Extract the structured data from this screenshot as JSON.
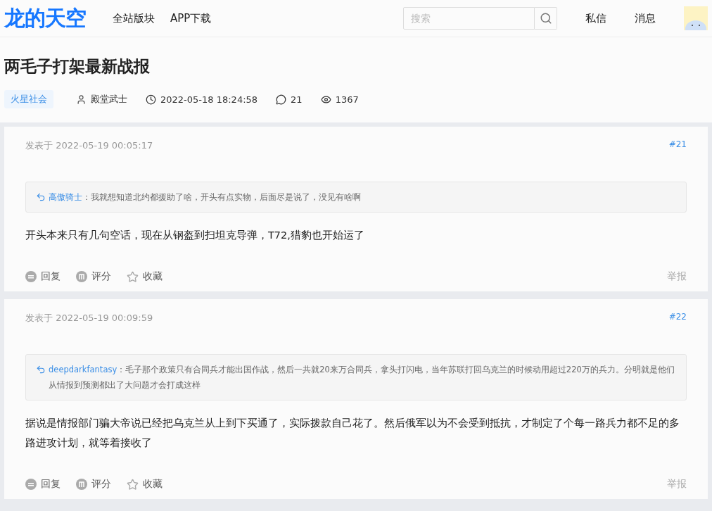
{
  "header": {
    "logo": "龙的天空",
    "nav": [
      "全站版块",
      "APP下载"
    ],
    "search": {
      "placeholder": "搜索"
    },
    "links": [
      "私信",
      "消息"
    ]
  },
  "thread": {
    "title": "两毛子打架最新战报",
    "tag": "火星社会",
    "author": "殿堂武士",
    "time": "2022-05-18 18:24:58",
    "replies": "21",
    "views": "1367"
  },
  "posts": [
    {
      "posted": "发表于 2022-05-19 00:05:17",
      "floor": "#21",
      "quote": {
        "user": "高傲骑士",
        "text": "：我就想知道北约都援助了啥，开头有点实物，后面尽是说了，没见有啥啊"
      },
      "content": "开头本来只有几句空话，现在从钢盔到扫坦克导弹，T72,猎豹也开始运了",
      "actions": [
        "回复",
        "评分",
        "收藏"
      ],
      "report": "举报"
    },
    {
      "posted": "发表于 2022-05-19 00:09:59",
      "floor": "#22",
      "quote": {
        "user": "deepdarkfantasy",
        "text": "：毛子那个政策只有合同兵才能出国作战，然后一共就20来万合同兵，拿头打闪电，当年苏联打回乌克兰的时候动用超过220万的兵力。分明就是他们从情报到预测都出了大问题才会打成这样"
      },
      "content": "据说是情报部门骗大帝说已经把乌克兰从上到下买通了，实际拨款自己花了。然后俄军以为不会受到抵抗，才制定了个每一路兵力都不足的多路进攻计划，就等着接收了",
      "actions": [
        "回复",
        "评分",
        "收藏"
      ],
      "report": "举报"
    }
  ]
}
